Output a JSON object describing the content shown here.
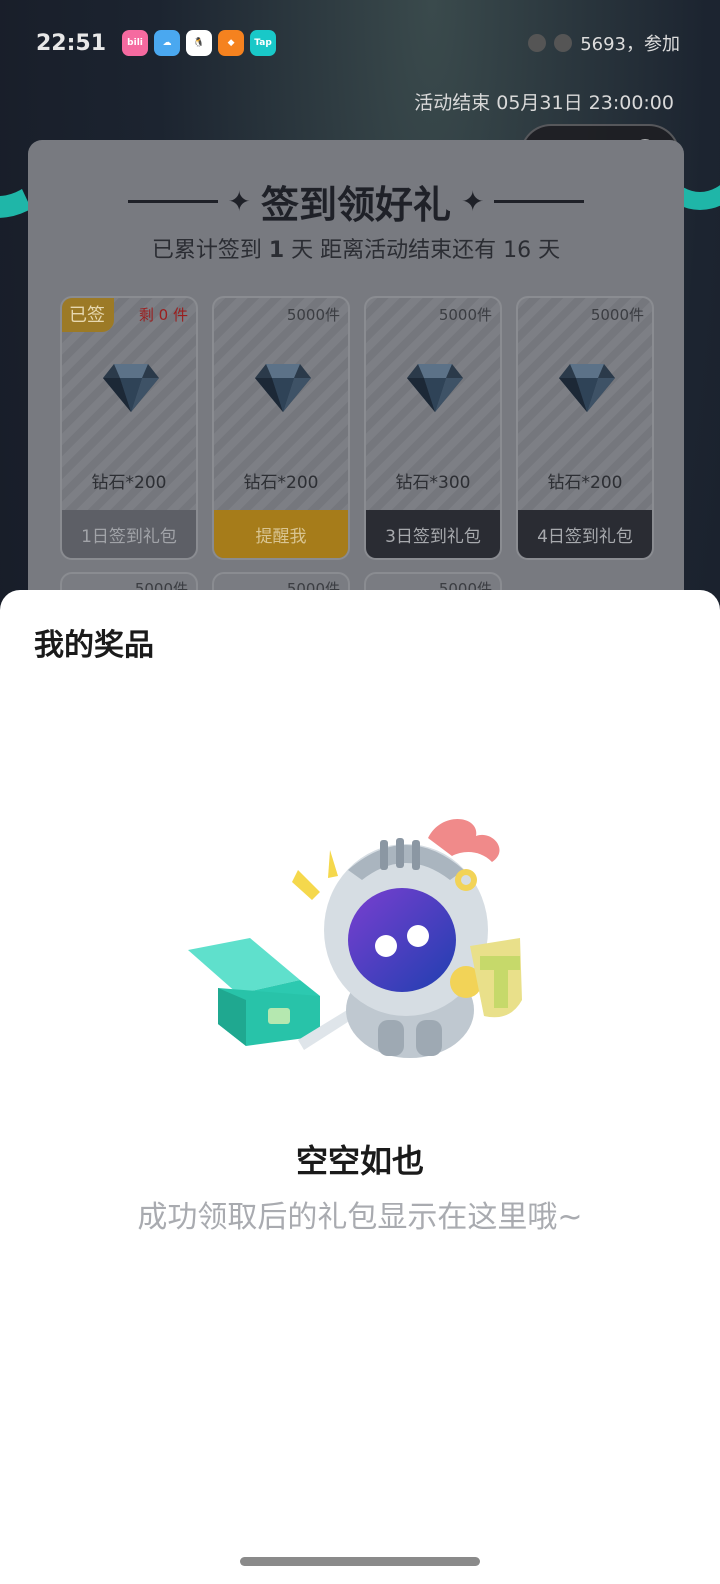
{
  "status_bar": {
    "time": "22:51",
    "apps": [
      {
        "name": "bilibili-app-icon",
        "label": "bili",
        "color": "#f56aa0"
      },
      {
        "name": "weather-app-icon",
        "label": "",
        "color": "#4aa8f0"
      },
      {
        "name": "qq-app-icon",
        "label": "",
        "color": "#ffffff"
      },
      {
        "name": "game-app-icon",
        "label": "",
        "color": "#f5821f"
      },
      {
        "name": "taptap-app-icon",
        "label": "Tap",
        "color": "#19c8c8"
      }
    ],
    "right_text": "5693，参加"
  },
  "activity": {
    "end_text": "活动结束 05月31日 23:00:00"
  },
  "capsule": {
    "share_icon": "share-icon",
    "close_icon": "target-close-icon"
  },
  "card": {
    "title": "签到领好礼",
    "subtitle_prefix": "已累计签到",
    "signed_days": "1",
    "subtitle_mid": "天  距离活动结束还有",
    "days_left": "16",
    "subtitle_suffix": "天"
  },
  "gifts": [
    {
      "stock": "剩 0 件",
      "badge": "已签",
      "name": "钻石*200",
      "button": "1日签到礼包",
      "state": "claimed"
    },
    {
      "stock": "5000件",
      "badge": "",
      "name": "钻石*200",
      "button": "提醒我",
      "state": "remind"
    },
    {
      "stock": "5000件",
      "badge": "",
      "name": "钻石*300",
      "button": "3日签到礼包",
      "state": "locked"
    },
    {
      "stock": "5000件",
      "badge": "",
      "name": "钻石*200",
      "button": "4日签到礼包",
      "state": "locked"
    }
  ],
  "gifts_row2": [
    {
      "stock": "5000件"
    },
    {
      "stock": "5000件"
    },
    {
      "stock": "5000件"
    }
  ],
  "sheet": {
    "title": "我的奖品",
    "empty_title": "空空如也",
    "empty_desc": "成功领取后的礼包显示在这里哦~",
    "illustration": "knight-mascot-with-treasure-chest"
  }
}
